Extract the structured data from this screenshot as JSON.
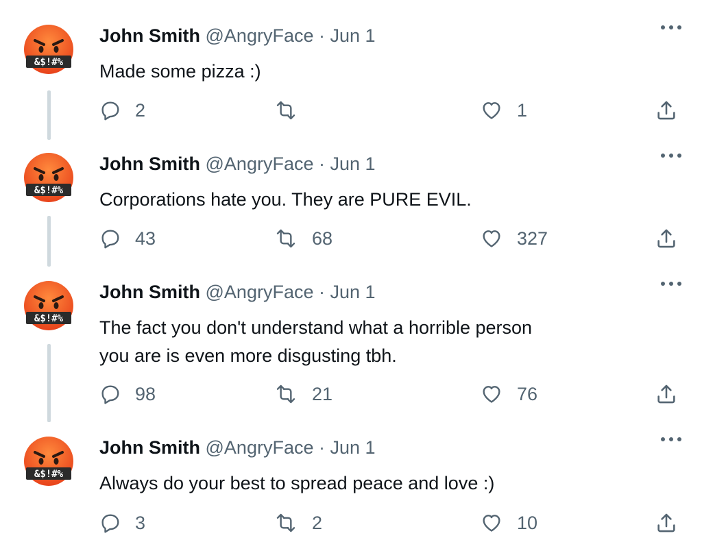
{
  "tweets": [
    {
      "name": "John Smith",
      "handle": "@AngryFace",
      "separator": "·",
      "date": "Jun 1",
      "text": "Made some pizza :)",
      "replies": "2",
      "retweets": "",
      "likes": "1",
      "avatar_icon": "angry-face-with-symbols-emoji",
      "avatar_symbols": "&$!#%"
    },
    {
      "name": "John Smith",
      "handle": "@AngryFace",
      "separator": "·",
      "date": "Jun 1",
      "text": "Corporations hate you. They are PURE EVIL.",
      "replies": "43",
      "retweets": "68",
      "likes": "327",
      "avatar_icon": "angry-face-with-symbols-emoji",
      "avatar_symbols": "&$!#%"
    },
    {
      "name": "John Smith",
      "handle": "@AngryFace",
      "separator": "·",
      "date": "Jun 1",
      "text_lines": [
        "The fact you don't understand what a horrible person",
        "you are is even more disgusting tbh."
      ],
      "replies": "98",
      "retweets": "21",
      "likes": "76",
      "avatar_icon": "angry-face-with-symbols-emoji",
      "avatar_symbols": "&$!#%"
    },
    {
      "name": "John Smith",
      "handle": "@AngryFace",
      "separator": "·",
      "date": "Jun 1",
      "text": "Always do your best to spread peace and love :)",
      "replies": "3",
      "retweets": "2",
      "likes": "10",
      "avatar_icon": "angry-face-with-symbols-emoji",
      "avatar_symbols": "&$!#%"
    }
  ],
  "colors": {
    "text_primary": "#0f1419",
    "text_secondary": "#536471",
    "thread_line": "#cfd9de",
    "emoji_face": "#f0641e"
  }
}
